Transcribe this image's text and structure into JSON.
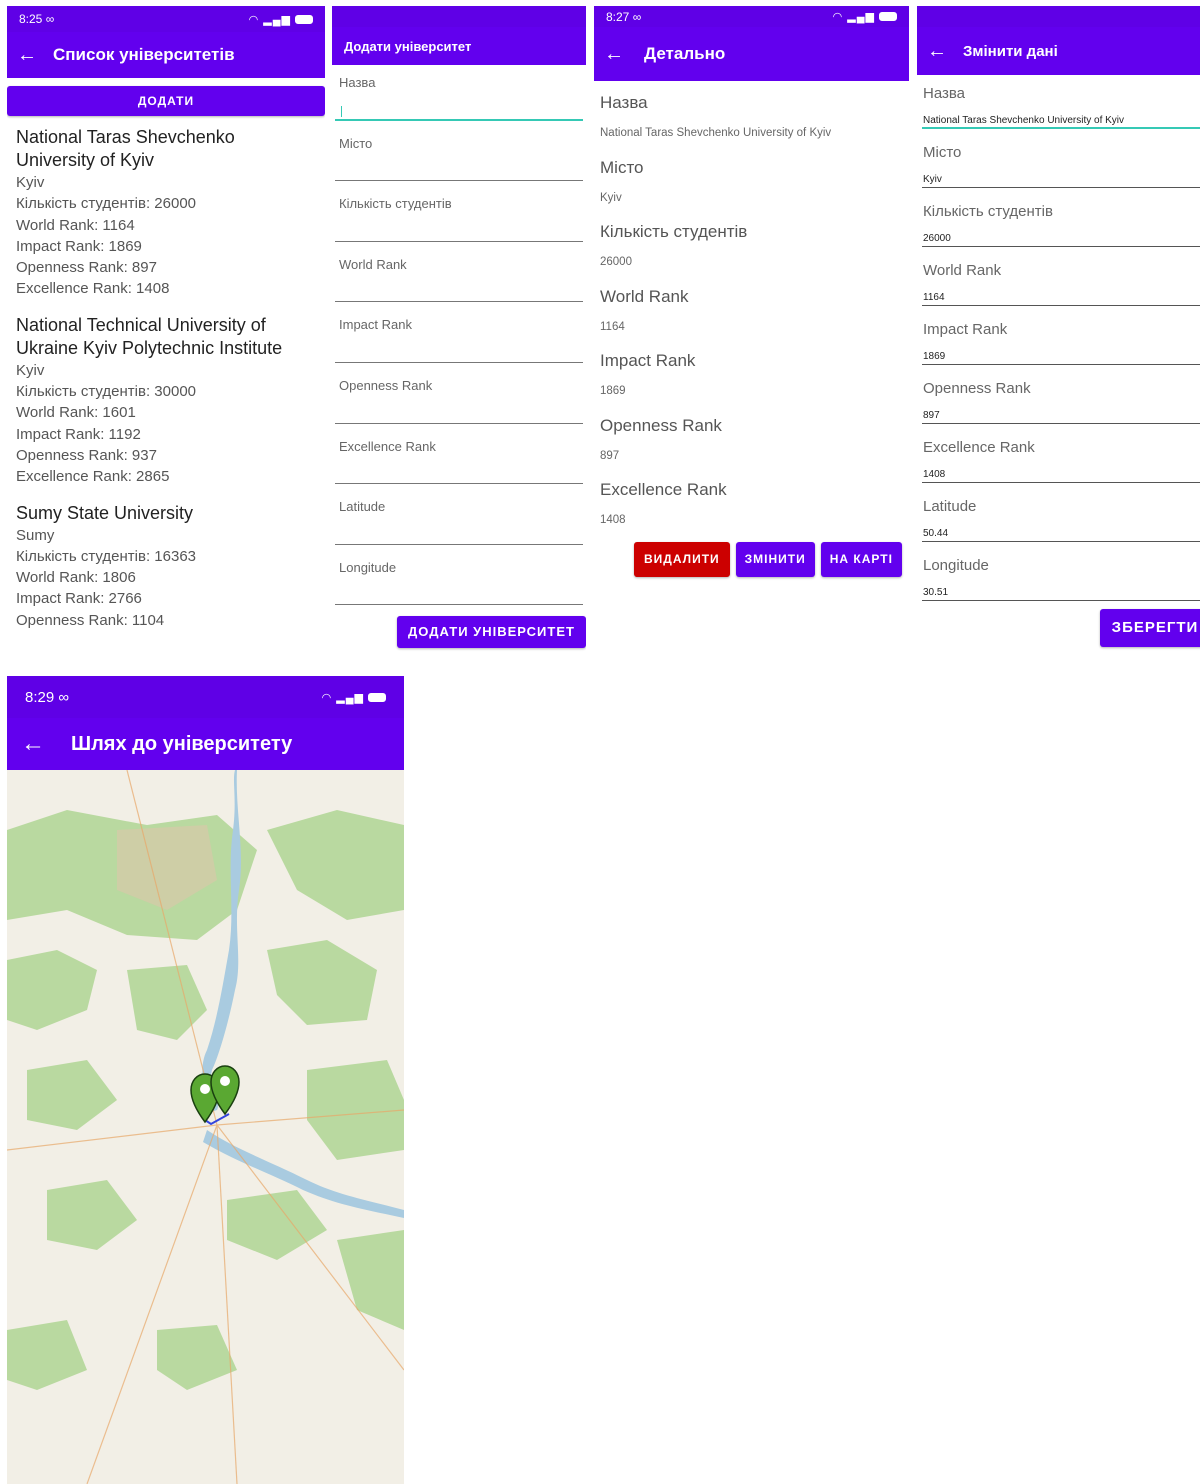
{
  "screen_list": {
    "status_time": "8:25 ∞",
    "title": "Список університетів",
    "add_button": "ДОДАТИ",
    "universities": [
      {
        "name": "National Taras Shevchenko University of Kyiv",
        "city": "Kyiv",
        "students": "Кількість студентів: 26000",
        "world_rank": "World Rank: 1164",
        "impact_rank": "Impact Rank: 1869",
        "openness_rank": "Openness Rank: 897",
        "excellence_rank": "Excellence Rank: 1408"
      },
      {
        "name": "National Technical University of Ukraine Kyiv Polytechnic Institute",
        "city": "Kyiv",
        "students": "Кількість студентів: 30000",
        "world_rank": "World Rank: 1601",
        "impact_rank": "Impact Rank: 1192",
        "openness_rank": "Openness Rank: 937",
        "excellence_rank": "Excellence Rank: 2865"
      },
      {
        "name": "Sumy State University",
        "city": "Sumy",
        "students": "Кількість студентів: 16363",
        "world_rank": "World Rank: 1806",
        "impact_rank": "Impact Rank: 2766",
        "openness_rank": "Openness Rank: 1104",
        "excellence_rank": ""
      }
    ]
  },
  "screen_add": {
    "title": "Додати університет",
    "fields": [
      "Назва",
      "Місто",
      "Кількість студентів",
      "World Rank",
      "Impact Rank",
      "Openness Rank",
      "Excellence Rank",
      "Latitude",
      "Longitude"
    ],
    "submit_button": "ДОДАТИ УНІВЕРСИТЕТ"
  },
  "screen_detail": {
    "status_time": "8:27 ∞",
    "title": "Детально",
    "rows": [
      {
        "label": "Назва",
        "value": "National Taras Shevchenko University of Kyiv"
      },
      {
        "label": "Місто",
        "value": "Kyiv"
      },
      {
        "label": "Кількість студентів",
        "value": "26000"
      },
      {
        "label": "World Rank",
        "value": "1164"
      },
      {
        "label": "Impact Rank",
        "value": "1869"
      },
      {
        "label": "Openness Rank",
        "value": "897"
      },
      {
        "label": "Excellence Rank",
        "value": "1408"
      }
    ],
    "delete_button": "ВИДАЛИТИ",
    "edit_button": "ЗМІНИТИ",
    "map_button": "НА КАРТІ"
  },
  "screen_edit": {
    "title": "Змінити дані",
    "fields": [
      {
        "label": "Назва",
        "value": "National Taras Shevchenko University of Kyiv"
      },
      {
        "label": "Місто",
        "value": "Kyiv"
      },
      {
        "label": "Кількість студентів",
        "value": "26000"
      },
      {
        "label": "World Rank",
        "value": "1164"
      },
      {
        "label": "Impact Rank",
        "value": "1869"
      },
      {
        "label": "Openness Rank",
        "value": "897"
      },
      {
        "label": "Excellence Rank",
        "value": "1408"
      },
      {
        "label": "Latitude",
        "value": "50.44"
      },
      {
        "label": "Longitude",
        "value": "30.51"
      }
    ],
    "save_button": "ЗБЕРЕГТИ"
  },
  "screen_map": {
    "status_time": "8:29 ∞",
    "title": "Шлях до університету"
  },
  "colors": {
    "primary": "#6200ee",
    "status_bar": "#5f00e6",
    "danger": "#cc0000",
    "focus_line": "#35c9b5",
    "map_land": "#f2efe6",
    "map_forest": "#b9d9a0",
    "map_water": "#a9cbe0",
    "marker": "#5aa832"
  },
  "icons": [
    "back-arrow-icon",
    "wifi-icon",
    "signal-icon",
    "battery-icon",
    "map-marker-icon"
  ]
}
